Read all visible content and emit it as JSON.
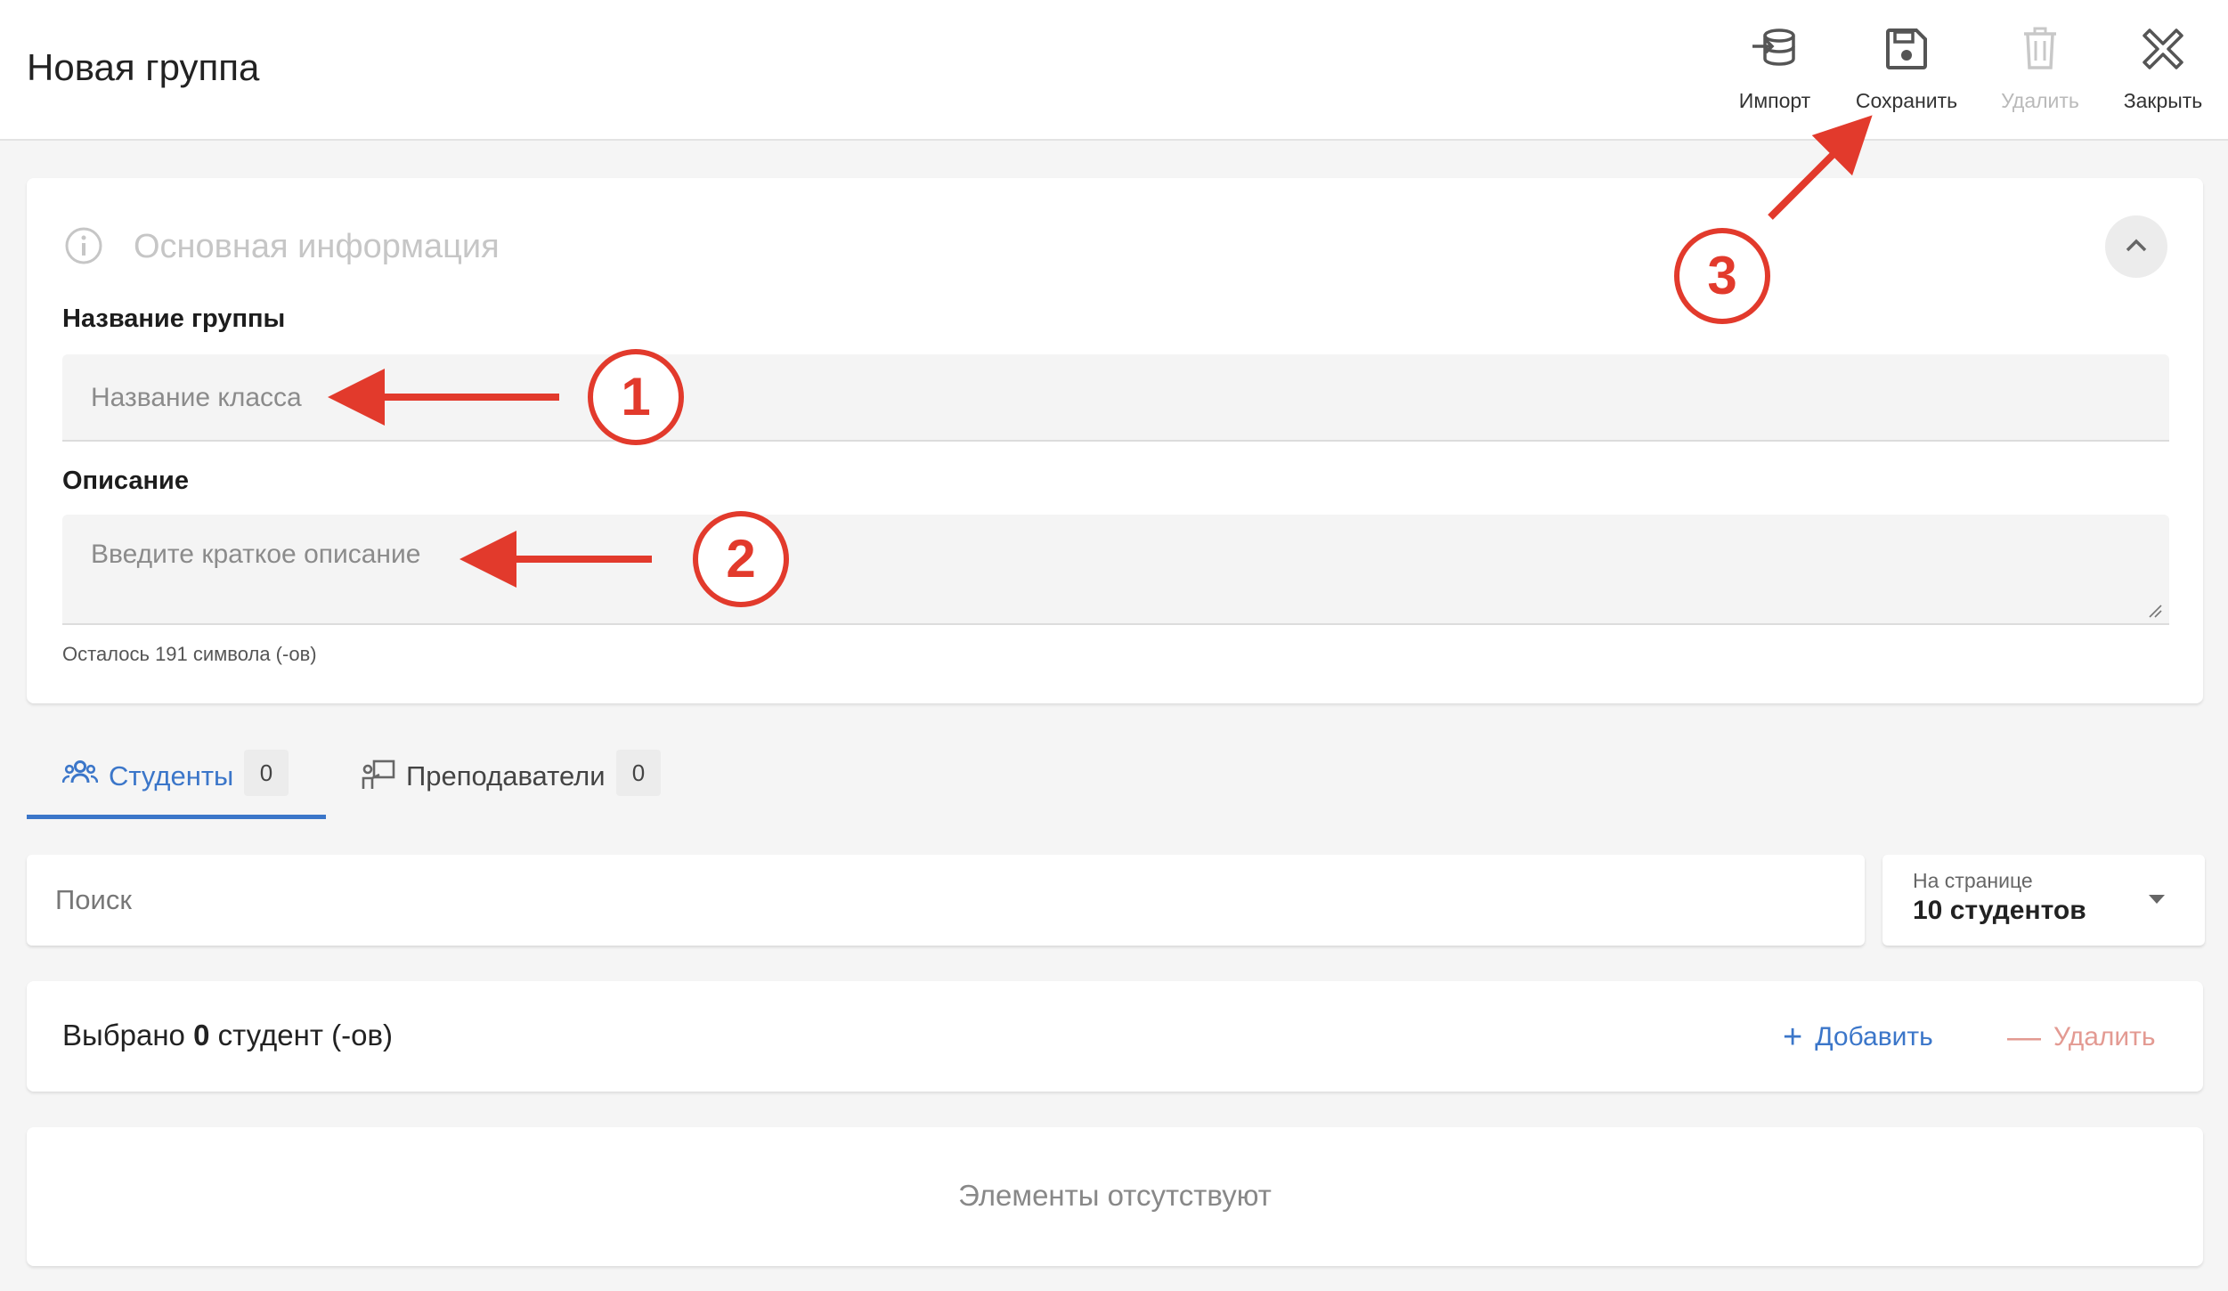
{
  "header": {
    "title": "Новая группа",
    "tools": {
      "import": "Импорт",
      "save": "Сохранить",
      "delete": "Удалить",
      "close": "Закрыть"
    }
  },
  "info_section": {
    "title": "Основная информация",
    "name_label": "Название группы",
    "name_placeholder": "Название класса",
    "desc_label": "Описание",
    "desc_placeholder": "Введите краткое описание",
    "chars_left": "Осталось 191 символа (-ов)"
  },
  "tabs": [
    {
      "label": "Студенты",
      "count": "0",
      "active": true
    },
    {
      "label": "Преподаватели",
      "count": "0",
      "active": false
    }
  ],
  "search": {
    "placeholder": "Поиск"
  },
  "per_page": {
    "label": "На странице",
    "value": "10 студентов"
  },
  "selection": {
    "prefix": "Выбрано",
    "count": "0",
    "suffix": "студент (-ов)",
    "add": "Добавить",
    "remove": "Удалить"
  },
  "empty_message": "Элементы отсутствуют",
  "annotations": [
    "1",
    "2",
    "3"
  ],
  "colors": {
    "accent": "#3b76c9",
    "annotation_red": "#e23a2c",
    "danger_light": "#e39a92"
  }
}
